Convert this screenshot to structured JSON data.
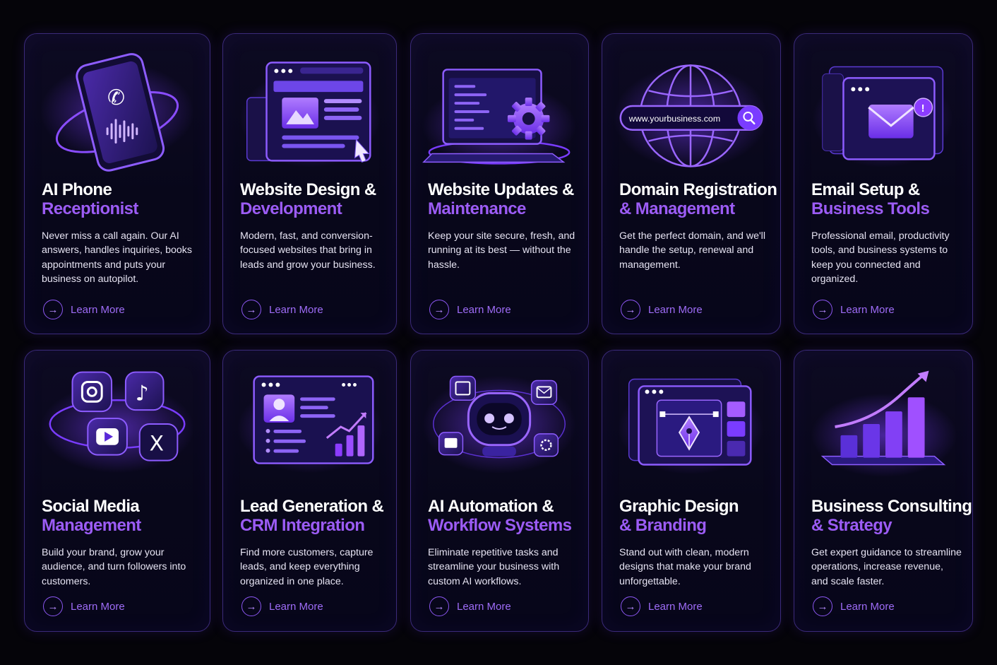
{
  "colors": {
    "background": "#050409",
    "accent": "#9c5cf5",
    "border": "#3b2a7a"
  },
  "cards": [
    {
      "icon": "phone-receptionist-icon",
      "title_line1": "AI Phone",
      "title_line2": "Receptionist",
      "description": "Never miss a call again. Our AI answers, handles inquiries, books appointments and puts your business on autopilot.",
      "cta": "Learn More"
    },
    {
      "icon": "website-design-icon",
      "title_line1": "Website Design &",
      "title_line2": "Development",
      "description": "Modern, fast, and conversion-focused websites that bring in leads and grow your business.",
      "cta": "Learn More"
    },
    {
      "icon": "laptop-gear-icon",
      "title_line1": "Website Updates &",
      "title_line2": "Maintenance",
      "description": "Keep your site secure, fresh, and running at its best — without the hassle.",
      "cta": "Learn More"
    },
    {
      "icon": "globe-domain-icon",
      "domain_text": "www.yourbusiness.com",
      "title_line1": "Domain Registration",
      "title_line2": "& Management",
      "description": "Get the perfect domain, and we'll handle the setup, renewal and management.",
      "cta": "Learn More"
    },
    {
      "icon": "email-window-icon",
      "title_line1": "Email Setup &",
      "title_line2": "Business Tools",
      "description": "Professional email, productivity tools, and business systems to keep you connected and organized.",
      "cta": "Learn More"
    },
    {
      "icon": "social-media-icons",
      "title_line1": "Social Media",
      "title_line2": "Management",
      "description": "Build your brand, grow your audience, and turn followers into customers.",
      "cta": "Learn More"
    },
    {
      "icon": "crm-dashboard-icon",
      "title_line1": "Lead Generation &",
      "title_line2": "CRM Integration",
      "description": "Find more customers, capture leads, and keep everything organized in one place.",
      "cta": "Learn More"
    },
    {
      "icon": "robot-automation-icon",
      "title_line1": "AI Automation &",
      "title_line2": "Workflow Systems",
      "description": "Eliminate repetitive tasks and streamline your business with custom AI workflows.",
      "cta": "Learn More"
    },
    {
      "icon": "pen-tool-design-icon",
      "title_line1": "Graphic Design",
      "title_line2": "& Branding",
      "description": "Stand out with clean, modern designs that make your brand unforgettable.",
      "cta": "Learn More"
    },
    {
      "icon": "growth-chart-icon",
      "title_line1": "Business Consulting",
      "title_line2": "& Strategy",
      "description": "Get expert guidance to streamline operations, increase revenue, and scale faster.",
      "cta": "Learn More"
    }
  ]
}
